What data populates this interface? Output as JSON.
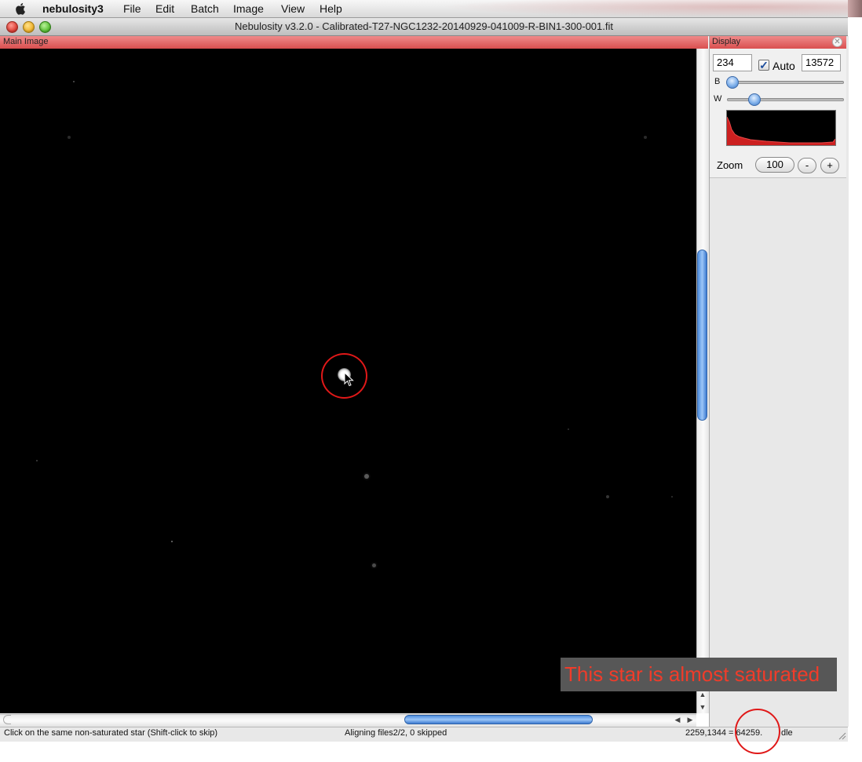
{
  "menubar": {
    "apple_icon": "apple-icon",
    "app_name": "nebulosity3",
    "items": [
      "File",
      "Edit",
      "Batch",
      "Image",
      "View",
      "Help"
    ]
  },
  "window": {
    "title": "Nebulosity v3.2.0 - Calibrated-T27-NGC1232-20140929-041009-R-BIN1-300-001.fit"
  },
  "main_panel": {
    "label": "Main Image"
  },
  "display_panel": {
    "label": "Display",
    "black_point": "234",
    "auto_label": "Auto",
    "auto_checked": true,
    "white_point": "13572",
    "b_label": "B",
    "w_label": "W",
    "b_slider_level": 0.0,
    "w_slider_level": 0.2,
    "zoom_label": "Zoom",
    "zoom_value": "100",
    "zoom_out_label": "-",
    "zoom_in_label": "+"
  },
  "status": {
    "instruction": "Click on the same non-saturated star (Shift-click to skip)",
    "progress": "Aligning files2/2, 0 skipped",
    "pixel_readout": "2259,1344 = 64259.",
    "state": "dle"
  },
  "annotation": {
    "text": "This star is almost saturated"
  },
  "colors": {
    "panel_header": "#e06060",
    "annotation_text": "#f03c2a",
    "annotation_bg": "#575757",
    "circle": "#e01818",
    "scroll_thumb": "#5b9be8",
    "histogram": "#d02020"
  },
  "scroll": {
    "arrow_up": "▲",
    "arrow_down": "▼",
    "arrow_left": "◀",
    "arrow_right": "▶"
  }
}
